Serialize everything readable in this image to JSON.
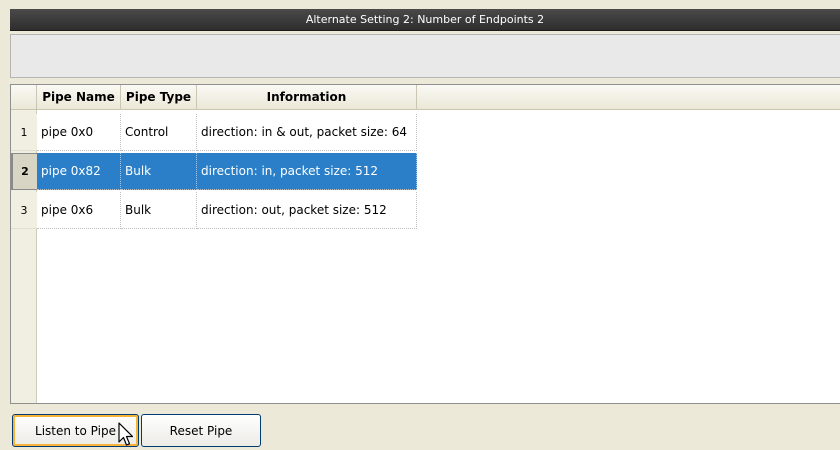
{
  "window": {
    "title": "Alternate Setting 2: Number of Endpoints 2"
  },
  "table": {
    "columns": [
      "Pipe Name",
      "Pipe Type",
      "Information"
    ],
    "rows": [
      {
        "num": "1",
        "name": "pipe 0x0",
        "type": "Control",
        "info": "direction: in & out, packet size: 64"
      },
      {
        "num": "2",
        "name": "pipe 0x82",
        "type": "Bulk",
        "info": "direction: in, packet size: 512"
      },
      {
        "num": "3",
        "name": "pipe 0x6",
        "type": "Bulk",
        "info": "direction: out, packet size: 512"
      }
    ],
    "selected_row": 2
  },
  "buttons": {
    "listen_label": "Listen to Pipe",
    "reset_label": "Reset Pipe"
  },
  "colors": {
    "selection": "#2a7fc8",
    "titlebar": "#3a3a3a",
    "focus_ring": "#f8b33a"
  },
  "icons": {
    "cursor": "mouse-pointer-icon"
  }
}
